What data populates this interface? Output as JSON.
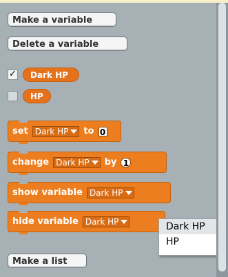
{
  "buttons": {
    "make_variable": "Make a variable",
    "delete_variable": "Delete a variable",
    "make_list": "Make a list"
  },
  "variables": [
    {
      "name": "Dark HP",
      "checked": true
    },
    {
      "name": "HP",
      "checked": false
    }
  ],
  "checkmark_glyph": "✓",
  "blocks": {
    "set": {
      "label": "set",
      "var": "Dark HP",
      "to_label": "to",
      "value": "0"
    },
    "change": {
      "label": "change",
      "var": "Dark HP",
      "by_label": "by",
      "value": "1"
    },
    "show": {
      "label": "show variable",
      "var": "Dark HP"
    },
    "hide": {
      "label": "hide variable",
      "var": "Dark HP"
    }
  },
  "popup_menu": {
    "options": [
      "Dark HP",
      "HP"
    ],
    "highlighted": "Dark HP"
  },
  "colors": {
    "background": "#A7B0B5",
    "block_orange": "#EC7E1F",
    "reporter_orange": "#E5711B"
  }
}
